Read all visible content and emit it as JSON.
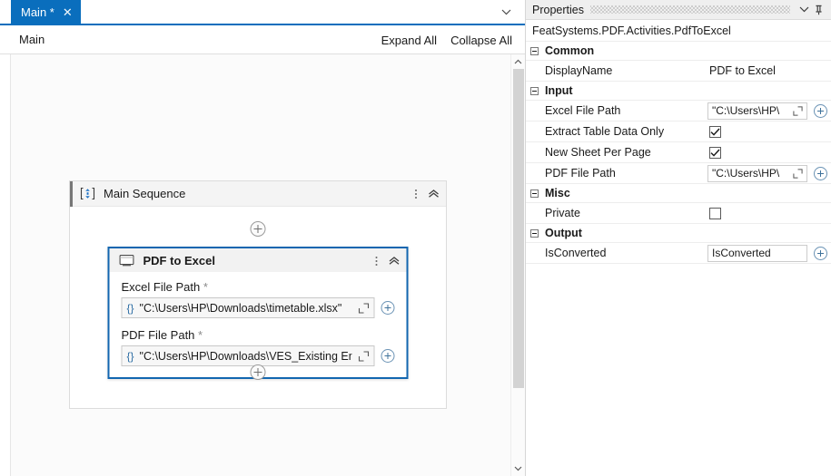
{
  "designer": {
    "tab": {
      "label": "Main *",
      "close_icon": "close-icon",
      "overflow_icon": "chevron-down-icon"
    },
    "breadcrumb": {
      "path": "Main"
    },
    "actions": {
      "expand_all": "Expand All",
      "collapse_all": "Collapse All"
    },
    "sequence": {
      "title": "Main Sequence",
      "icon": "sequence-icon",
      "kebab_icon": "more-options-icon",
      "collapse_icon": "chevron-up-icon",
      "add_icon": "add-activity-icon"
    },
    "activity": {
      "title": "PDF to Excel",
      "icon": "pdf-to-excel-icon",
      "kebab_icon": "more-options-icon",
      "collapse_icon": "chevron-up-icon",
      "accent_color": "#1266b0",
      "fields": [
        {
          "label": "Excel File Path",
          "required_marker": "*",
          "braces_icon": "expression-braces-icon",
          "value": "\"C:\\Users\\HP\\Downloads\\timetable.xlsx\"",
          "expand_icon": "open-expression-editor-icon",
          "plus_icon": "add-variable-icon"
        },
        {
          "label": "PDF File Path",
          "required_marker": "*",
          "braces_icon": "expression-braces-icon",
          "value": "\"C:\\Users\\HP\\Downloads\\VES_Existing En",
          "expand_icon": "open-expression-editor-icon",
          "plus_icon": "add-variable-icon"
        }
      ]
    },
    "scrollbar": {
      "up_icon": "scroll-up-icon",
      "down_icon": "scroll-down-icon"
    }
  },
  "properties": {
    "title": "Properties",
    "collapse_icon": "chevron-down-icon",
    "pin_icon": "pin-icon",
    "type_name": "FeatSystems.PDF.Activities.PdfToExcel",
    "groups": [
      {
        "label": "Common",
        "rows": [
          {
            "name": "DisplayName",
            "kind": "text",
            "value": "PDF to Excel"
          }
        ]
      },
      {
        "label": "Input",
        "rows": [
          {
            "name": "Excel File Path",
            "kind": "expression",
            "value": "\"C:\\Users\\HP\\",
            "expand_icon": "open-expression-editor-icon",
            "plus_icon": "add-variable-icon"
          },
          {
            "name": "Extract Table Data Only",
            "kind": "checkbox",
            "checked": true
          },
          {
            "name": "New Sheet Per Page",
            "kind": "checkbox",
            "checked": true
          },
          {
            "name": "PDF File Path",
            "kind": "expression",
            "value": "\"C:\\Users\\HP\\",
            "expand_icon": "open-expression-editor-icon",
            "plus_icon": "add-variable-icon"
          }
        ]
      },
      {
        "label": "Misc",
        "rows": [
          {
            "name": "Private",
            "kind": "checkbox",
            "checked": false
          }
        ]
      },
      {
        "label": "Output",
        "rows": [
          {
            "name": "IsConverted",
            "kind": "value",
            "value": "IsConverted",
            "plus_icon": "add-variable-icon"
          }
        ]
      }
    ]
  }
}
